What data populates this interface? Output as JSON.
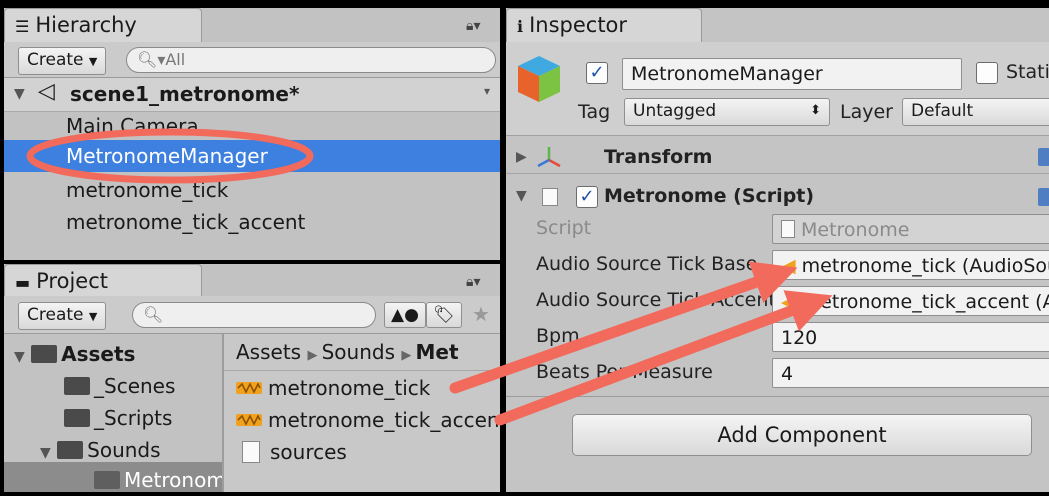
{
  "hierarchy": {
    "tab_label": "Hierarchy",
    "create_label": "Create",
    "search_placeholder": "All",
    "scene_name": "scene1_metronome*",
    "items": [
      "Main Camera",
      "MetronomeManager",
      "metronome_tick",
      "metronome_tick_accent"
    ],
    "selected_index": 1
  },
  "project": {
    "tab_label": "Project",
    "create_label": "Create",
    "search_placeholder": "",
    "tree": [
      "Assets",
      "_Scenes",
      "_Scripts",
      "Sounds",
      "Metronome"
    ],
    "breadcrumb": [
      "Assets",
      "Sounds",
      "Met"
    ],
    "files": [
      "metronome_tick",
      "metronome_tick_accent",
      "sources"
    ]
  },
  "inspector": {
    "tab_label": "Inspector",
    "object_name": "MetronomeManager",
    "static_label": "Static",
    "tag_label": "Tag",
    "tag_value": "Untagged",
    "layer_label": "Layer",
    "layer_value": "Default",
    "transform_label": "Transform",
    "script_component_label": "Metronome (Script)",
    "fields": {
      "script_label": "Script",
      "script_value": "Metronome",
      "tick_base_label": "Audio Source Tick Base",
      "tick_base_value": "metronome_tick (AudioSource)",
      "tick_accent_label": "Audio Source Tick Accent",
      "tick_accent_value": "metronome_tick_accent (AudioSource)",
      "bpm_label": "Bpm",
      "bpm_value": "120",
      "beats_label": "Beats Per Measure",
      "beats_value": "4"
    },
    "add_component_label": "Add Component"
  },
  "colors": {
    "selection": "#3d80df",
    "annotation": "#f26a5b"
  }
}
